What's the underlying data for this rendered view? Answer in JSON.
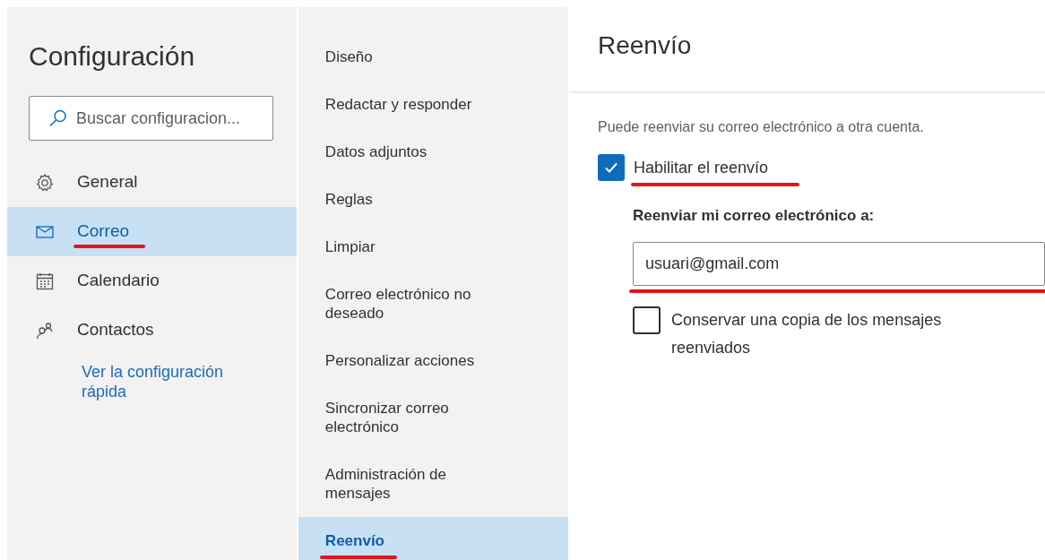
{
  "settings": {
    "title": "Configuración",
    "search": {
      "placeholder": "Buscar configuracion..."
    },
    "nav_items": [
      {
        "label": "General",
        "selected": false,
        "underlined": false
      },
      {
        "label": "Correo",
        "selected": true,
        "underlined": true
      },
      {
        "label": "Calendario",
        "selected": false,
        "underlined": false
      },
      {
        "label": "Contactos",
        "selected": false,
        "underlined": false
      }
    ],
    "quick_settings_link": "Ver la configuración rápida"
  },
  "submenu": [
    {
      "label": "Diseño",
      "selected": false,
      "underlined": false
    },
    {
      "label": "Redactar y responder",
      "selected": false,
      "underlined": false
    },
    {
      "label": "Datos adjuntos",
      "selected": false,
      "underlined": false
    },
    {
      "label": "Reglas",
      "selected": false,
      "underlined": false
    },
    {
      "label": "Limpiar",
      "selected": false,
      "underlined": false
    },
    {
      "label": "Correo electrónico no deseado",
      "selected": false,
      "underlined": false
    },
    {
      "label": "Personalizar acciones",
      "selected": false,
      "underlined": false
    },
    {
      "label": "Sincronizar correo electrónico",
      "selected": false,
      "underlined": false
    },
    {
      "label": "Administración de mensajes",
      "selected": false,
      "underlined": false
    },
    {
      "label": "Reenvío",
      "selected": true,
      "underlined": true
    }
  ],
  "forwarding": {
    "title": "Reenvío",
    "description": "Puede reenviar su correo electrónico a otra cuenta.",
    "enable": {
      "label": "Habilitar el reenvío",
      "checked": true,
      "underlined": true
    },
    "address_label": "Reenviar mi correo electrónico a:",
    "address": {
      "value": "usuari@gmail.com",
      "underlined": true
    },
    "keep_copy": {
      "label": "Conservar una copia de los mensajes reenviados",
      "checked": false
    }
  }
}
